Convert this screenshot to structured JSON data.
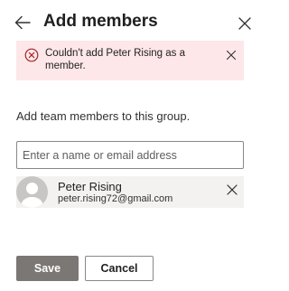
{
  "header": {
    "title": "Add members"
  },
  "error": {
    "message": "Couldn't add Peter Rising as a member."
  },
  "instruction": "Add team members to this group.",
  "search": {
    "placeholder": "Enter a name or email address",
    "value": ""
  },
  "member": {
    "name": "Peter Rising",
    "email": "peter.rising72@gmail.com"
  },
  "buttons": {
    "save_label": "Save",
    "cancel_label": "Cancel"
  },
  "colors": {
    "error_background": "#fde7e9",
    "error_icon": "#a4262c",
    "save_button_background": "#7b7775",
    "chip_background": "#f3f2f1"
  },
  "icons": {
    "back": "back-arrow-icon",
    "close": "close-icon",
    "error": "error-circle-icon",
    "dismiss_error": "dismiss-icon",
    "remove_member": "remove-member-icon",
    "avatar": "person-placeholder-icon"
  }
}
